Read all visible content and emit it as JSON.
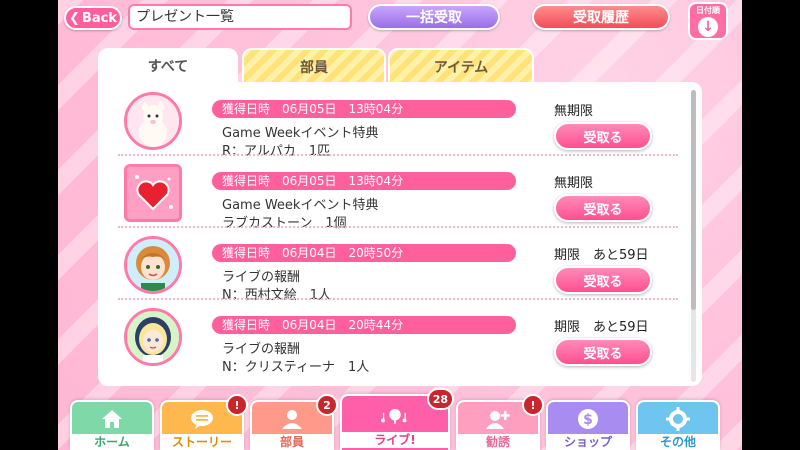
{
  "header": {
    "back_label": "Back",
    "title": "プレゼント一覧",
    "bulk_receive_label": "一括受取",
    "history_label": "受取履歴",
    "sort_label": "日付順"
  },
  "tabs": [
    {
      "label": "すべて"
    },
    {
      "label": "部員"
    },
    {
      "label": "アイテム"
    }
  ],
  "gifts": [
    {
      "date": "獲得日時　06月05日　13時04分",
      "line1": "Game Weekイベント特典",
      "line2": "R：アルパカ　1匹",
      "expiry": "無期限",
      "receive_label": "受取る"
    },
    {
      "date": "獲得日時　06月05日　13時04分",
      "line1": "Game Weekイベント特典",
      "line2": "ラブカストーン　1個",
      "expiry": "無期限",
      "receive_label": "受取る"
    },
    {
      "date": "獲得日時　06月04日　20時50分",
      "line1": "ライブの報酬",
      "line2": "N：西村文絵　1人",
      "expiry": "期限　あと59日",
      "receive_label": "受取る"
    },
    {
      "date": "獲得日時　06月04日　20時44分",
      "line1": "ライブの報酬",
      "line2": "N：クリスティーナ　1人",
      "expiry": "期限　あと59日",
      "receive_label": "受取る"
    }
  ],
  "nav": [
    {
      "label": "ホーム",
      "color": "#7fd8a8",
      "label_color": "#3aa56d",
      "icon": "home-icon",
      "badge": ""
    },
    {
      "label": "ストーリー",
      "color": "#ffb84d",
      "label_color": "#e08a00",
      "icon": "chat-icon",
      "badge": "!"
    },
    {
      "label": "部員",
      "color": "#ff9a8a",
      "label_color": "#e06a58",
      "icon": "members-icon",
      "badge": "2"
    },
    {
      "label": "ライブ!",
      "color": "#ff5fa8",
      "label_color": "#e83d8a",
      "icon": "music-icon",
      "badge": "28"
    },
    {
      "label": "勧誘",
      "color": "#ff9fc0",
      "label_color": "#e86a98",
      "icon": "recruit-icon",
      "badge": "!"
    },
    {
      "label": "ショップ",
      "color": "#a98cf0",
      "label_color": "#7a5ed0",
      "icon": "shop-icon",
      "badge": ""
    },
    {
      "label": "その他",
      "color": "#6ec6f0",
      "label_color": "#2f97cc",
      "icon": "gear-icon",
      "badge": ""
    }
  ]
}
